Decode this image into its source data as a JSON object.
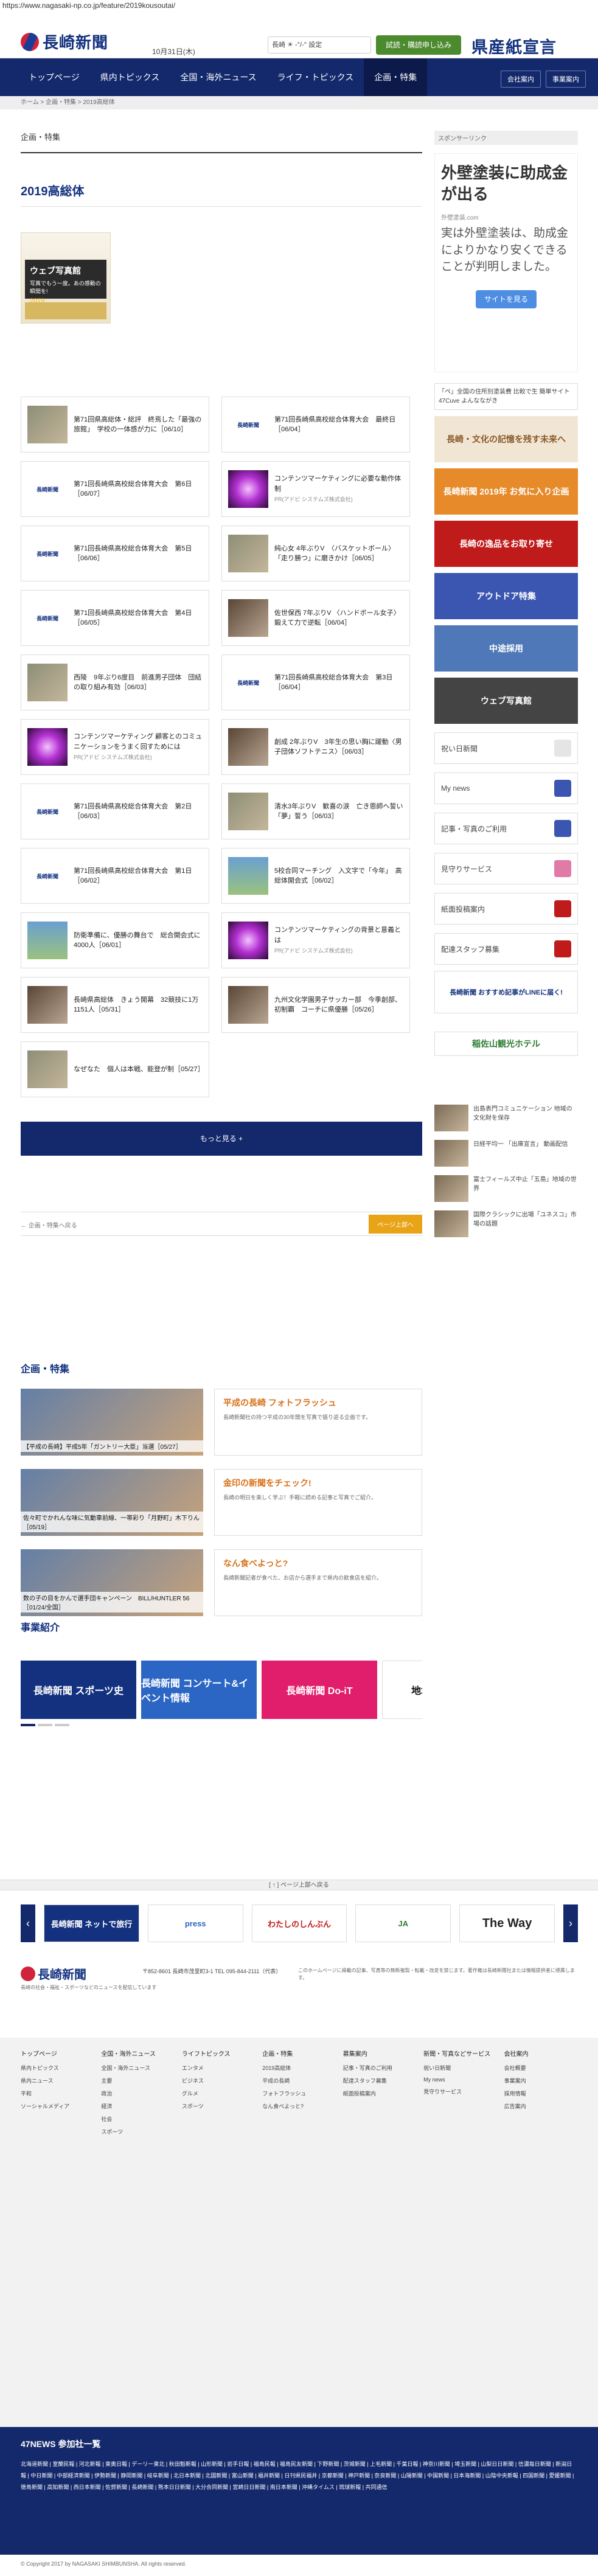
{
  "browser": {
    "url": "https://www.nagasaki-np.co.jp/feature/2019kousoutai/"
  },
  "header": {
    "logo": "長崎新聞",
    "date": "10月31日(木)",
    "weather": "長崎 ☀ -°/-° 設定",
    "subscribe": "試読・購読申し込み",
    "brand_right": "県産紙宣言"
  },
  "nav": {
    "items": [
      "トップページ",
      "県内トピックス",
      "全国・海外ニュース",
      "ライフ・トピックス",
      "企画・特集"
    ],
    "right": [
      "会社案内",
      "事業案内"
    ]
  },
  "breadcrumb": "ホーム > 企画・特集 > 2019高総体",
  "main": {
    "section": "企画・特集",
    "title": "2019高総体",
    "photo_title": "ウェブ写真館",
    "photo_sub": "写真でもう一度。あの感動の瞬間を!",
    "photo_year": "2019",
    "articles": [
      {
        "title": "第71回県高総体・総評　終焉した「最強の旅館」　学校の一体感が力に［06/10］",
        "img": "photo"
      },
      {
        "title": "第71回長崎県高校総合体育大会　最終日［06/04］",
        "img": "logo"
      },
      {
        "title": "第71回長崎県高校総合体育大会　第6日［06/07］",
        "img": "logo"
      },
      {
        "title": "コンテンツマーケティングに必要な動作体制",
        "img": "neon",
        "pr": "PR(アドビ システムズ株式会社)"
      },
      {
        "title": "第71回長崎県高校総合体育大会　第5日［06/06］",
        "img": "logo"
      },
      {
        "title": "純心女 4年ぶりV　〈バスケットボール〉「走り勝つ」に磨きかけ［06/05］",
        "img": "photo"
      },
      {
        "title": "第71回長崎県高校総合体育大会　第4日［06/05］",
        "img": "logo"
      },
      {
        "title": "佐世保西 7年ぶりV 〈ハンドボール女子〉 鍛えて力で逆転［06/04］",
        "img": "crowd"
      },
      {
        "title": "西陵　9年ぶり6度目　前進男子団体　団結の取り組み有効［06/03］",
        "img": "photo"
      },
      {
        "title": "第71回長崎県高校総合体育大会　第3日［06/04］",
        "img": "logo"
      },
      {
        "title": "コンテンツマーケティング 顧客とのコミュニケーションをうまく回すためには",
        "img": "neon",
        "pr": "PR(アドビ システムズ株式会社)"
      },
      {
        "title": "創成 2年ぶりV　3年生の思い胸に躍動〈男子団体ソフトテニス〉［06/03］",
        "img": "crowd"
      },
      {
        "title": "第71回長崎県高校総合体育大会　第2日［06/03］",
        "img": "logo"
      },
      {
        "title": "清水3年ぶりV　歓喜の涙　亡き恩師へ誓い「夢」誓う［06/03］",
        "img": "photo"
      },
      {
        "title": "第71回長崎県高校総合体育大会　第1日［06/02］",
        "img": "logo"
      },
      {
        "title": "5校合同マーチング　入文字で「今年」　高総体開会式［06/02］",
        "img": "field"
      },
      {
        "title": "防衛準備に、優勝の舞台で　総合開会式に4000人［06/01］",
        "img": "field"
      },
      {
        "title": "コンテンツマーケティングの背景と意義とは",
        "img": "neon",
        "pr": "PR(アドビ システムズ株式会社)"
      },
      {
        "title": "長崎県高総体　きょう開幕　32競技に1万1151人［05/31］",
        "img": "crowd"
      },
      {
        "title": "九州文化学園男子サッカー部　今季創部、初制覇　コーチに県優勝［05/26］",
        "img": "crowd"
      },
      {
        "title": "なぜなた　個人は本戦、能登が制［05/27］",
        "img": "photo"
      }
    ],
    "more": "もっと見る +",
    "back": "← 企画・特集へ戻る",
    "pagetop": "ページ上部へ"
  },
  "features": {
    "heading": "企画・特集",
    "items": [
      {
        "caption": "【平成の長崎】平成5年「ガントリー大臣」当選［05/27］",
        "title": "平成の長崎 フォトフラッシュ",
        "desc": "長崎新聞社の持つ平成の30年間を写真で振り返る企画です。"
      },
      {
        "caption": "佐々町でかれんな味に気動車前線、一帯彩り「月野町」木下りん［05/19］",
        "title": "金印の新聞をチェック!",
        "desc": "長崎の明日を楽しく学ぶ！手軽に読める記事と写真でご紹介。"
      },
      {
        "caption": "数の子の目をかんで選手団キャンペーン　BILL/HUNTLER 56［01/24/全国］",
        "title": "なん食べよっと?",
        "desc": "長崎新聞記者が食べた、お店から選手まで県内の飲食店を紹介。"
      }
    ]
  },
  "jigyo": {
    "heading": "事業紹介",
    "banners": [
      "長崎新聞 スポーツ史",
      "長崎新聞 コンサート&イベント情報",
      "長崎新聞 Do-iT",
      "地域×ク FAA"
    ]
  },
  "sidebar": {
    "sponsor": "スポンサーリンク",
    "ad_title": "外壁塗装に助成金が出る",
    "ad_domain": "外壁塗装.com",
    "ad_body": "実は外壁塗装は、助成金によりかなり安くできることが判明しました。",
    "ad_button": "サイトを見る",
    "ad_text": "「ペ」全国の住所別塗装費 比較で生 簡単サイト 47Cuve よんなながき",
    "banners": [
      "長崎・文化の記憶を残す未来へ",
      "長崎新聞 2019年 お気に入り企画",
      "長崎の逸品をお取り寄せ",
      "アウトドア特集",
      "中途採用",
      "ウェブ写真館"
    ],
    "links": [
      "祝い日新聞",
      "My news",
      "記事・写真のご利用",
      "見守りサービス",
      "紙面投稿案内",
      "配達スタッフ募集"
    ],
    "app_label": "長崎新聞 おすすめ記事がLINEに届く!",
    "hotel": "稲佐山観光ホテル",
    "news": [
      "出島表門コミュニケーション 地域の文化財を保存",
      "日経平均一 「出庫宣言」 動画配信",
      "富士フィールズ中止「五島」地域の世界",
      "国際クラシックに出場「ユネスコ」市場の話題"
    ]
  },
  "bottom_bar": "[ ↑ ] ページ上部へ戻る",
  "partners": [
    "長崎新聞 ネットで旅行",
    "press",
    "わたしのしんぶん",
    "JA",
    "The Way"
  ],
  "footer": {
    "logo": "長崎新聞",
    "address": "〒852-8601 長崎市茂里町3-1 TEL 095-844-2111（代表）",
    "note": "このホームページに掲載の記事、写真等の無断複製・転載・改変を禁じます。著作権は長崎新聞社または情報提供者に帰属します。",
    "link": "長崎の社会・福祉・スポーツなどのニュースを配信しています",
    "sitemap": [
      {
        "h": "トップページ",
        "items": [
          "県内トピックス",
          "県内ニュース",
          "平和",
          "ソーシャルメディア"
        ]
      },
      {
        "h": "全国・海外ニュース",
        "items": [
          "全国・海外ニュース",
          "主要",
          "政治",
          "経済",
          "社会",
          "スポーツ"
        ]
      },
      {
        "h": "ライフトピックス",
        "items": [
          "エンタメ",
          "ビジネス",
          "グルメ",
          "スポーツ"
        ]
      },
      {
        "h": "企画・特集",
        "items": [
          "2019高総体",
          "平成の長崎",
          "フォトフラッシュ",
          "なん食べよっと?"
        ]
      },
      {
        "h": "募集案内",
        "items": [
          "記事・写真のご利用",
          "配達スタッフ募集",
          "紙面投稿案内"
        ]
      },
      {
        "h": "新聞・写真などサービス",
        "items": [
          "祝い日新聞",
          "My news",
          "見守りサービス"
        ]
      },
      {
        "h": "会社案内",
        "items": [
          "会社概要",
          "事業案内",
          "採用情報",
          "広告案内"
        ]
      }
    ]
  },
  "news47": {
    "heading": "47NEWS 参加社一覧",
    "sites": "北海道新聞 | 室蘭民報 | 河北新報 | 東奥日報 | デーリー東北 | 秋田魁新報 | 山形新聞 | 岩手日報 | 福島民報 | 福島民友新聞 | 下野新聞 | 茨城新聞 | 上毛新聞 | 千葉日報 | 神奈川新聞 | 埼玉新聞 | 山梨日日新聞 | 信濃毎日新聞 | 新潟日報 | 中日新聞 | 中部経済新聞 | 伊勢新聞 | 静岡新聞 | 岐阜新聞 | 北日本新聞 | 北國新聞 | 富山新聞 | 福井新聞 | 日刊県民福井 | 京都新聞 | 神戸新聞 | 奈良新聞 | 山陽新聞 | 中国新聞 | 日本海新聞 | 山陰中央新報 | 四国新聞 | 愛媛新聞 | 徳島新聞 | 高知新聞 | 西日本新聞 | 佐賀新聞 | 長崎新聞 | 熊本日日新聞 | 大分合同新聞 | 宮崎日日新聞 | 南日本新聞 | 沖縄タイムス | 琉球新報 | 共同通信"
  },
  "copyright": "© Copyright 2017 by NAGASAKI SHIMBUNSHA. All rights reserved."
}
